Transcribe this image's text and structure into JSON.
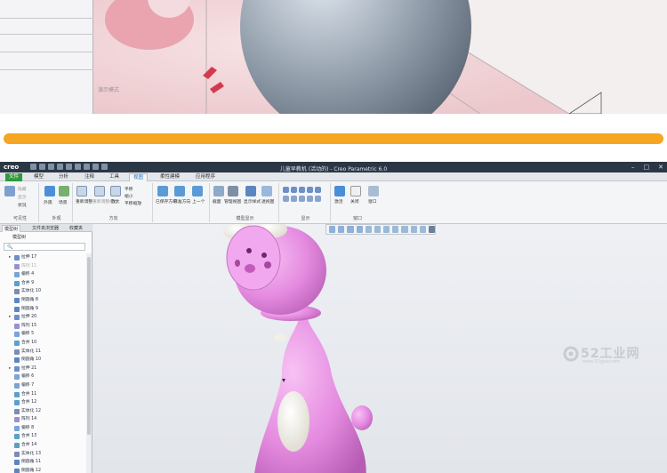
{
  "top_shot": {
    "mode_label": "演示模式"
  },
  "window": {
    "logo": "creo",
    "title": "儿童早教机 (活动的) - Creo Parametric 6.0"
  },
  "menu": {
    "tabs": [
      "文件",
      "模型",
      "分析",
      "注释",
      "工具",
      "视图",
      "柔性建模",
      "应用程序"
    ],
    "active": "视图"
  },
  "ribbon": {
    "visibility": {
      "label": "可见性",
      "items": [
        "隐藏",
        "显示",
        "状况"
      ]
    },
    "appearance": {
      "label": "外观",
      "items": [
        "外观",
        "场景"
      ]
    },
    "orientation": {
      "label": "方向",
      "items": [
        "重新调整",
        "放大",
        "缩小",
        "平移",
        "平移缩放",
        "已保存方向",
        "标准方向",
        "上一个"
      ],
      "extra": [
        "重新调整模型",
        "透视图"
      ]
    },
    "model_display": {
      "label": "模型显示",
      "items": [
        "截面",
        "管理视图",
        "显示样式",
        "透视图"
      ]
    },
    "show": {
      "label": "显示"
    },
    "window": {
      "label": "窗口",
      "items": [
        "激活",
        "关闭",
        "窗口"
      ]
    }
  },
  "watermark": {
    "name": "52工业网",
    "url": "www.52gyw.com"
  },
  "panel": {
    "tabs": [
      "模型树",
      "文件夹浏览器",
      "收藏夹"
    ],
    "tree_header": "模型树",
    "items": [
      {
        "label": "拉伸 17",
        "type": "extrude",
        "collapsed": true
      },
      {
        "label": "阵列 11",
        "type": "pattern",
        "dim": true
      },
      {
        "label": "偏移 4",
        "type": "offset"
      },
      {
        "label": "合并 9",
        "type": "merge"
      },
      {
        "label": "实体化 10",
        "type": "solidify"
      },
      {
        "label": "倒圆角 8",
        "type": "round"
      },
      {
        "label": "倒圆角 9",
        "type": "round"
      },
      {
        "label": "拉伸 20",
        "type": "extrude",
        "collapsed": true
      },
      {
        "label": "阵列 15",
        "type": "pattern"
      },
      {
        "label": "偏移 5",
        "type": "offset"
      },
      {
        "label": "合并 10",
        "type": "merge"
      },
      {
        "label": "实体化 11",
        "type": "solidify"
      },
      {
        "label": "倒圆角 10",
        "type": "round"
      },
      {
        "label": "拉伸 21",
        "type": "extrude",
        "collapsed": true
      },
      {
        "label": "偏移 6",
        "type": "offset"
      },
      {
        "label": "偏移 7",
        "type": "offset"
      },
      {
        "label": "合并 11",
        "type": "merge"
      },
      {
        "label": "合并 12",
        "type": "merge"
      },
      {
        "label": "实体化 12",
        "type": "solidify"
      },
      {
        "label": "阵列 14",
        "type": "pattern"
      },
      {
        "label": "偏移 8",
        "type": "offset"
      },
      {
        "label": "合并 13",
        "type": "merge"
      },
      {
        "label": "合并 14",
        "type": "merge"
      },
      {
        "label": "实体化 13",
        "type": "solidify"
      },
      {
        "label": "倒圆角 11",
        "type": "round"
      },
      {
        "label": "倒圆角 12",
        "type": "round"
      }
    ]
  },
  "colors": {
    "accent_orange": "#f6a623",
    "file_tab": "#2f9a3b",
    "title_bar": "#2b3744",
    "model_pink": "#e58be0",
    "model_white": "#f3f2ea"
  }
}
